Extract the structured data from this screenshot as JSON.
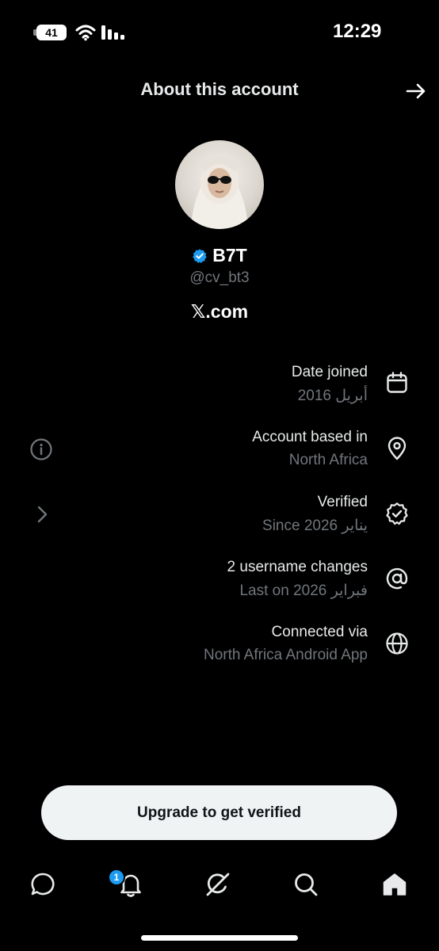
{
  "status_bar": {
    "time": "12:29",
    "battery": "41"
  },
  "header": {
    "title": "About this account"
  },
  "profile": {
    "display_name": "B7T",
    "handle": "@cv_bt3",
    "site": "𝕏.com"
  },
  "info_rows": [
    {
      "title": "Date joined",
      "value": "أبريل 2016",
      "icon": "calendar-icon"
    },
    {
      "title": "Account based in",
      "value": "North Africa",
      "icon": "location-pin-icon"
    },
    {
      "title": "Verified",
      "value": "Since يناير 2026",
      "icon": "verified-badge-icon"
    },
    {
      "title": "2 username changes",
      "value": "Last on فبراير 2026",
      "icon": "at-sign-icon"
    },
    {
      "title": "Connected via",
      "value": "North Africa Android App",
      "icon": "globe-icon"
    }
  ],
  "upgrade_button": {
    "label": "Upgrade to get verified"
  },
  "tab_bar": {
    "notification_count": "1",
    "tabs": [
      "messages-icon",
      "notifications-icon",
      "grok-icon",
      "search-icon",
      "home-icon"
    ]
  },
  "colors": {
    "background": "#000000",
    "accent": "#1d9bf0",
    "muted": "#71767b",
    "button_bg": "#eff3f4"
  }
}
